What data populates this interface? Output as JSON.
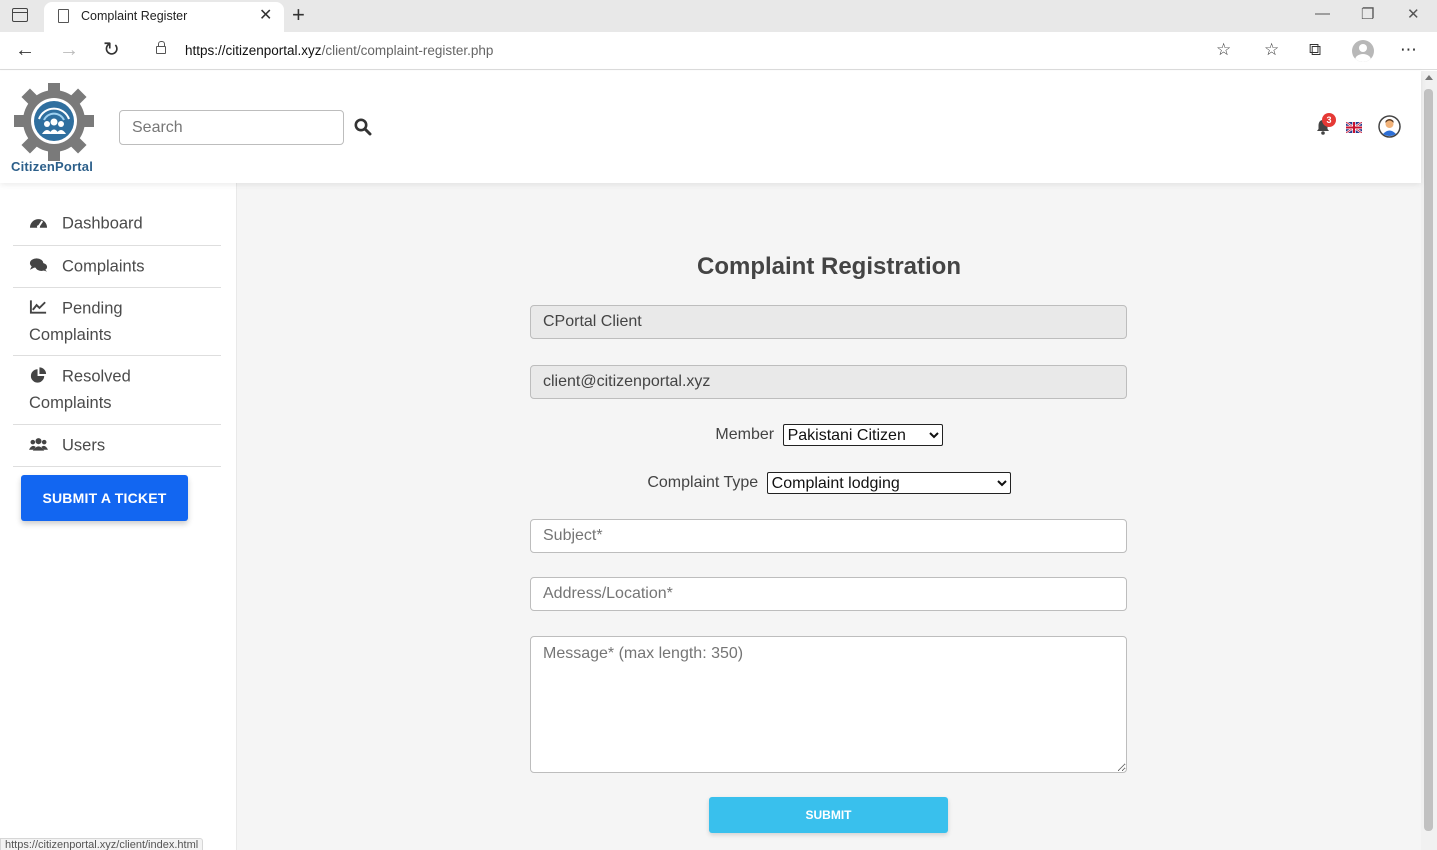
{
  "browser": {
    "tab_title": "Complaint Register",
    "url_host": "https://citizenportal.xyz",
    "url_path": "/client/complaint-register.php",
    "status_url": "https://citizenportal.xyz/client/index.html"
  },
  "header": {
    "logo_text": "CitizenPortal",
    "search_placeholder": "Search",
    "notification_count": "3"
  },
  "sidebar": {
    "items": [
      {
        "label": "Dashboard",
        "icon": "tachometer-icon"
      },
      {
        "label": "Complaints",
        "icon": "comments-icon"
      },
      {
        "label_line1": "Pending",
        "label_line2": "Complaints",
        "icon": "chart-line-icon"
      },
      {
        "label_line1": "Resolved",
        "label_line2": "Complaints",
        "icon": "chart-pie-icon"
      },
      {
        "label": "Users",
        "icon": "users-icon"
      }
    ],
    "submit_ticket_label": "SUBMIT A TICKET"
  },
  "form": {
    "title": "Complaint Registration",
    "name_value": "CPortal Client",
    "email_value": "client@citizenportal.xyz",
    "member_label": "Member",
    "member_selected": "Pakistani Citizen",
    "complaint_type_label": "Complaint Type",
    "complaint_type_selected": "Complaint lodging",
    "subject_placeholder": "Subject*",
    "address_placeholder": "Address/Location*",
    "message_placeholder": "Message* (max length: 350)",
    "submit_label": "SUBMIT"
  },
  "colors": {
    "primary_button": "#1266f1",
    "submit_button": "#39c0ed",
    "badge": "#e53935",
    "logo_text": "#2c5f8a"
  }
}
